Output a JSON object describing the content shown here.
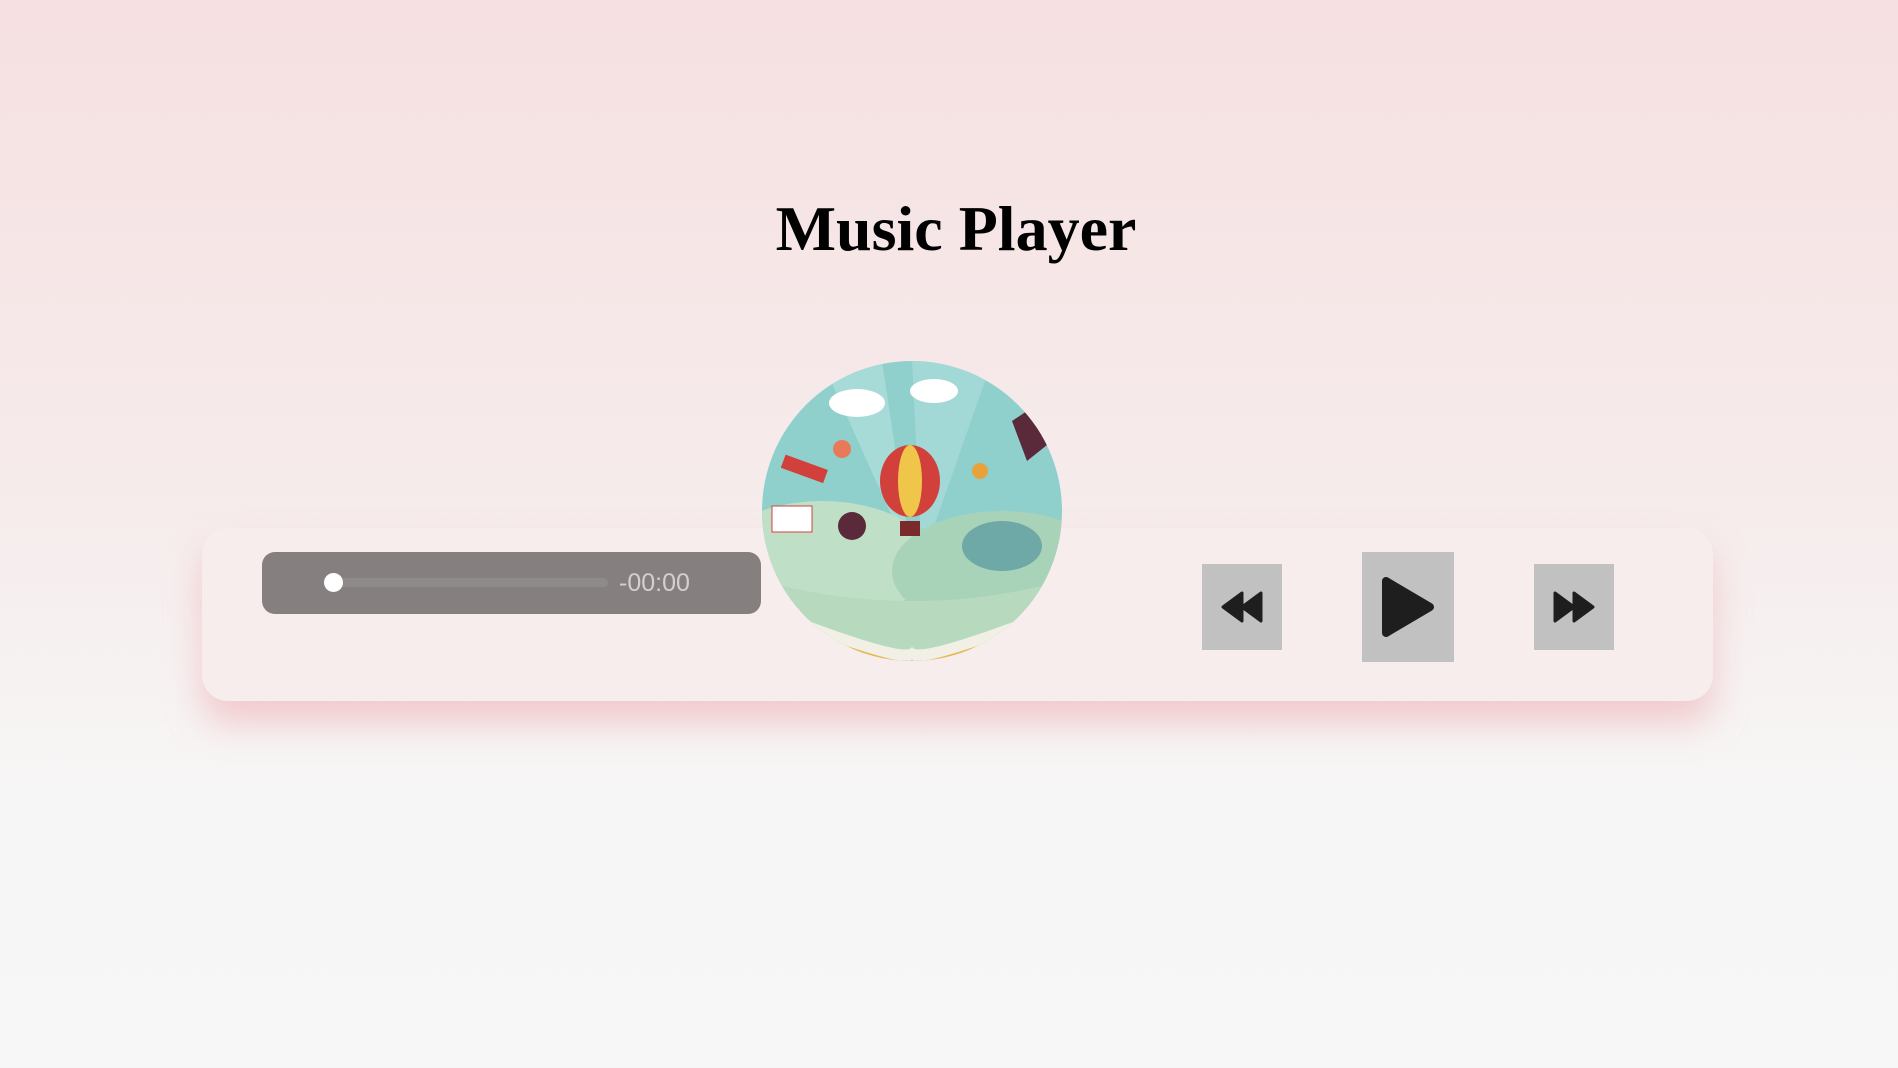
{
  "header": {
    "title": "Music Player"
  },
  "player": {
    "time_remaining": "-00:00",
    "progress_fraction": 0,
    "controls": {
      "rewind": "rewind-icon",
      "play": "play-icon",
      "forward": "fast-forward-icon"
    },
    "colors": {
      "audio_bar": "#857f7f",
      "button": "#c1c1c1",
      "icon": "#1e1e1e"
    }
  }
}
